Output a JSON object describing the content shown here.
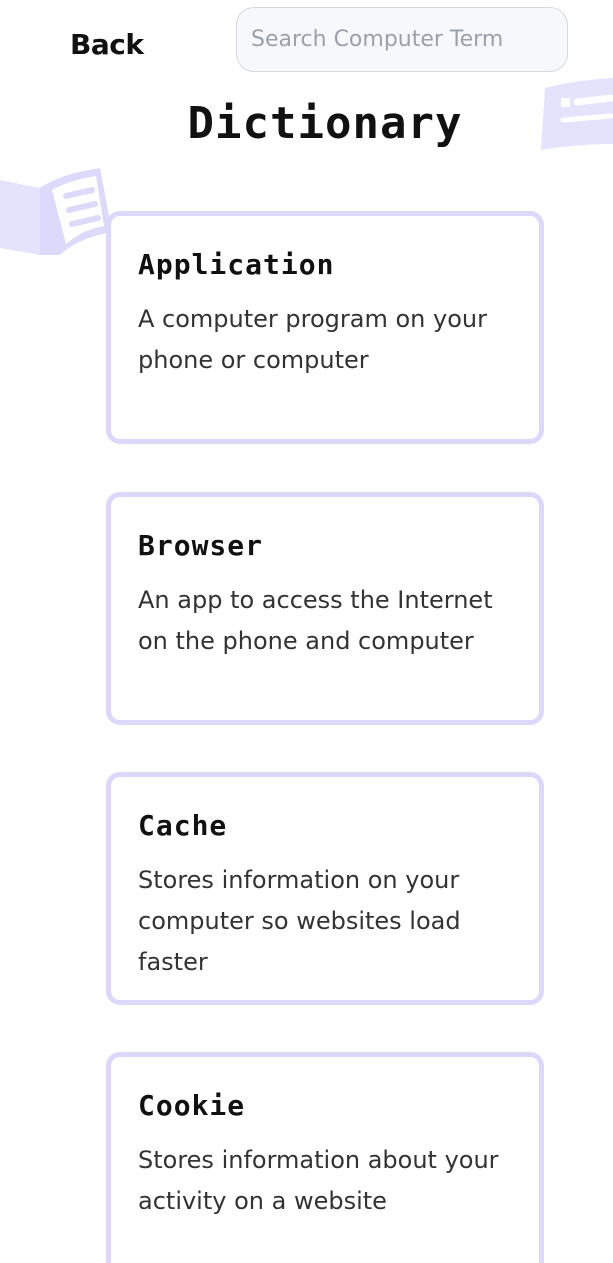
{
  "header": {
    "back_label": "Back",
    "search_placeholder": "Search Computer Term"
  },
  "title": "Dictionary",
  "colors": {
    "card_border": "#dcd8fb",
    "decoration": "#dcd8fb",
    "text": "#111111"
  },
  "terms": [
    {
      "term": "Application",
      "definition": "A computer program on your phone or computer"
    },
    {
      "term": "Browser",
      "definition": "An app to access the Internet on the phone and computer"
    },
    {
      "term": "Cache",
      "definition": "Stores information on your computer so websites load faster"
    },
    {
      "term": "Cookie",
      "definition": "Stores information about your activity on a website"
    }
  ],
  "decorations": [
    "book-illustration-icon",
    "screen-illustration-icon"
  ]
}
